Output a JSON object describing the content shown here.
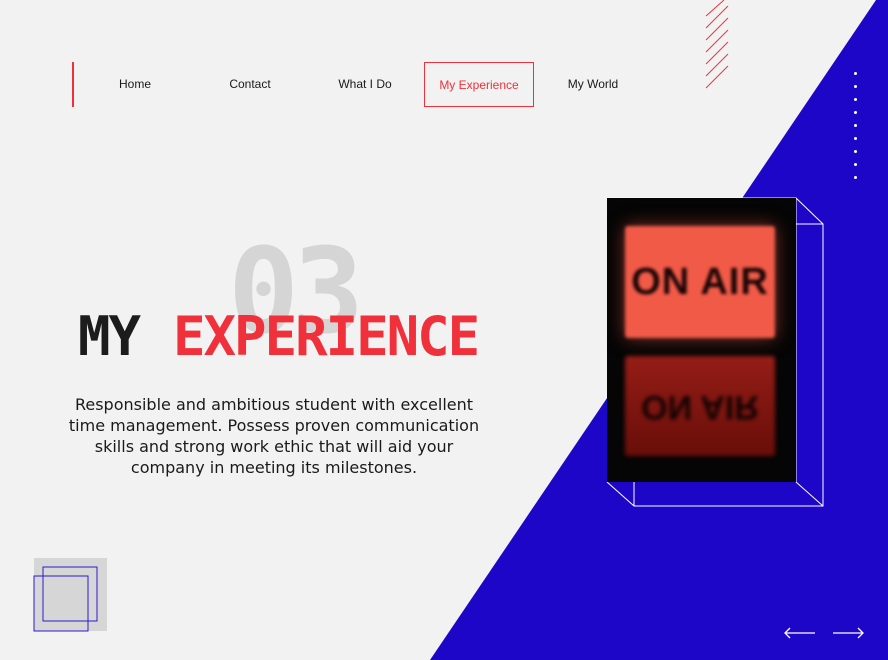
{
  "nav": {
    "items": [
      {
        "label": "Home",
        "active": false
      },
      {
        "label": "Contact",
        "active": false
      },
      {
        "label": "What I Do",
        "active": false
      },
      {
        "label": "My Experience",
        "active": true
      },
      {
        "label": "My World",
        "active": false
      }
    ]
  },
  "hero": {
    "section_number": "03",
    "title_part1": "MY",
    "title_part2": "EXPERIENCE",
    "description": "Responsible and ambitious student with excellent time management. Possess proven communication skills and strong work ethic that will aid your company in meeting its milestones."
  },
  "photo": {
    "sign_text": "ON AIR",
    "icon": "on-air-sign-photo"
  },
  "controls": {
    "prev_icon": "arrow-left-icon",
    "next_icon": "arrow-right-icon"
  },
  "colors": {
    "accent": "#f0303a",
    "blue": "#1e06c8",
    "background": "#f2f2f2",
    "heading": "#1c1c1c"
  }
}
